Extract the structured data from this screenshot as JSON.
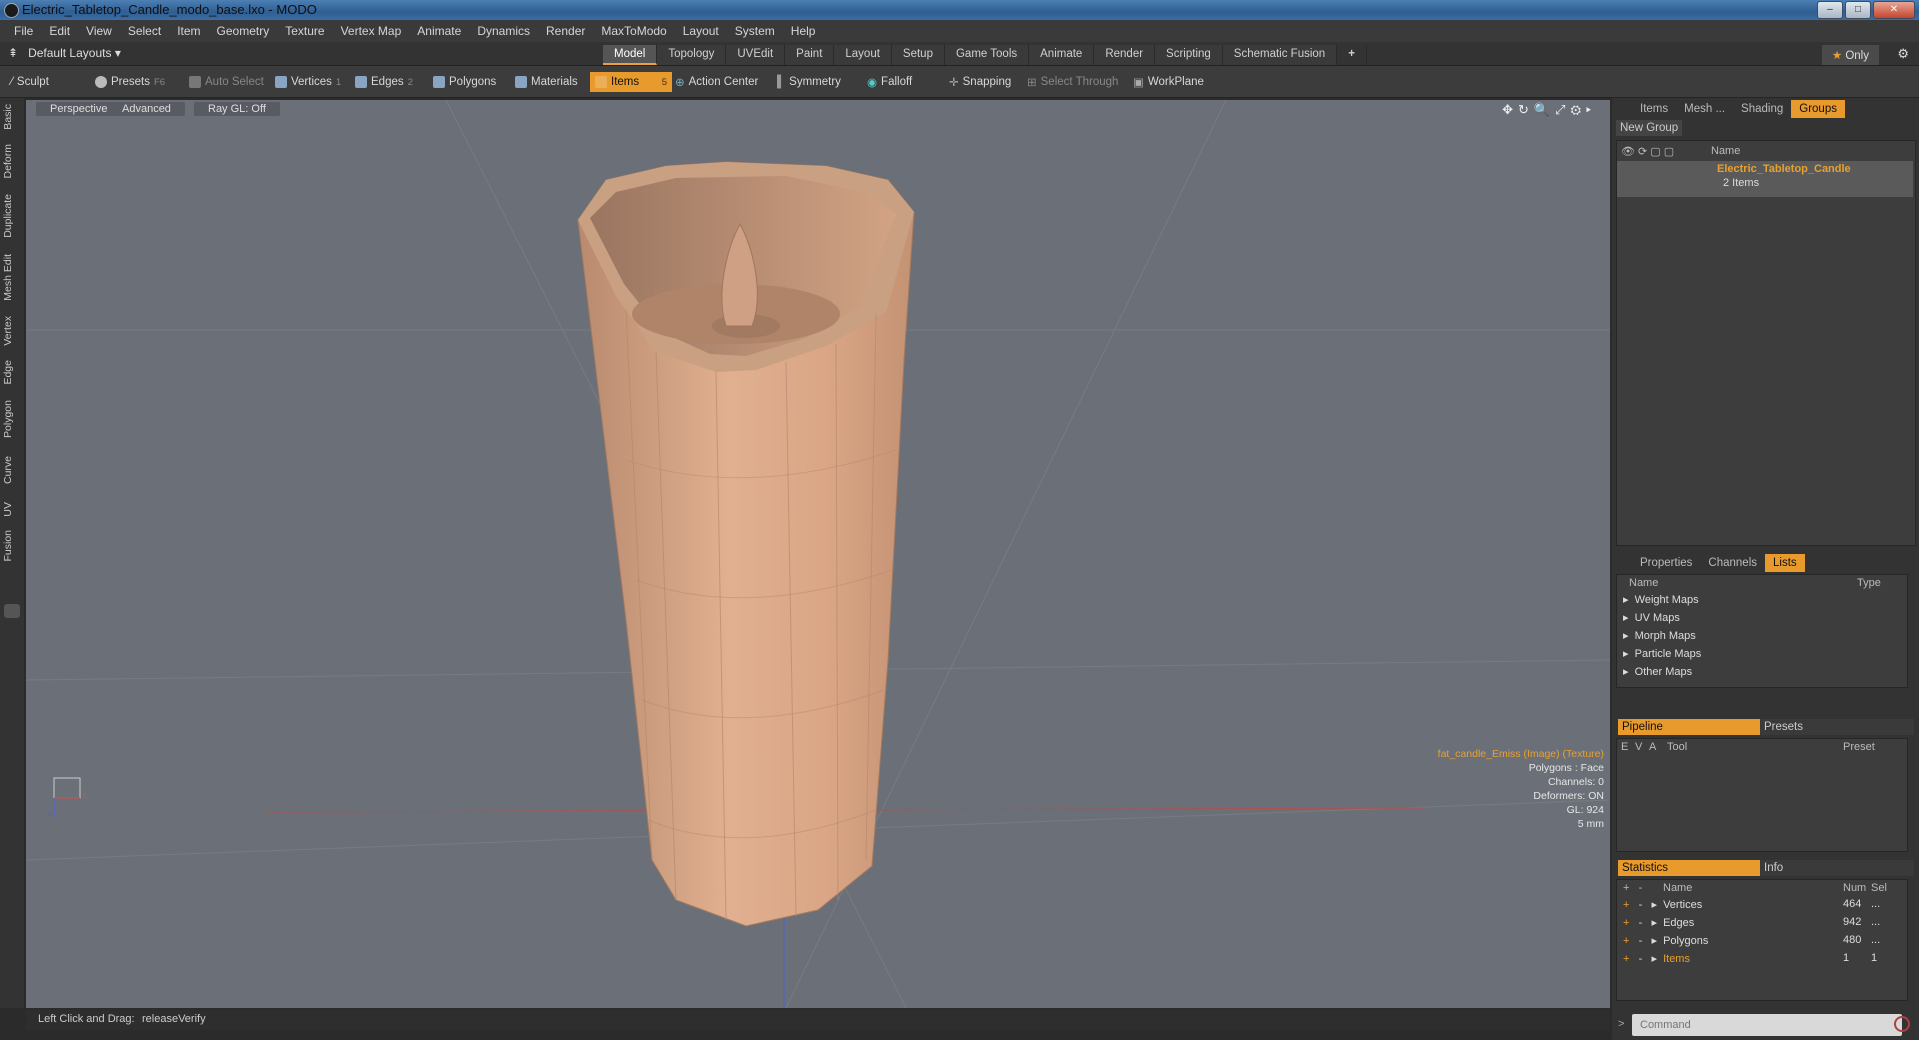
{
  "window": {
    "title": "Electric_Tabletop_Candle_modo_base.lxo - MODO"
  },
  "menu": [
    "File",
    "Edit",
    "View",
    "Select",
    "Item",
    "Geometry",
    "Texture",
    "Vertex Map",
    "Animate",
    "Dynamics",
    "Render",
    "MaxToModo",
    "Layout",
    "System",
    "Help"
  ],
  "layoutbar": {
    "layout": "Default Layouts",
    "tabs": [
      "Model",
      "Topology",
      "UVEdit",
      "Paint",
      "Layout",
      "Setup",
      "Game Tools",
      "Animate",
      "Render",
      "Scripting",
      "Schematic Fusion"
    ],
    "active_tab": "Model",
    "only_label": "Only"
  },
  "toolbar": {
    "sculpt": "Sculpt",
    "presets": "Presets",
    "presets_key": "F6",
    "auto_select": "Auto Select",
    "vertices": "Vertices",
    "vertices_num": "1",
    "edges": "Edges",
    "edges_num": "2",
    "polygons": "Polygons",
    "materials": "Materials",
    "items": "Items",
    "items_num": "5",
    "action_center": "Action Center",
    "symmetry": "Symmetry",
    "falloff": "Falloff",
    "snapping": "Snapping",
    "select_through": "Select Through",
    "workplane": "WorkPlane"
  },
  "lefttabs": [
    "Basic",
    "Deform",
    "Duplicate",
    "Mesh Edit",
    "Vertex",
    "Edge",
    "Polygon",
    "Curve",
    "UV",
    "Fusion"
  ],
  "viewport": {
    "view": "Perspective",
    "advanced": "Advanced",
    "raygl": "Ray GL: Off",
    "info": {
      "texture": "fat_candle_Emiss (Image) (Texture)",
      "polygons": "Polygons : Face",
      "channels": "Channels: 0",
      "deformers": "Deformers: ON",
      "gl": "GL: 924",
      "scale": "5 mm"
    }
  },
  "status": {
    "hint": "Left Click and Drag:",
    "action": "releaseVerify"
  },
  "groups_panel": {
    "tabs": [
      "Items",
      "Mesh ...",
      "Shading",
      "Groups"
    ],
    "active": "Groups",
    "new_group": "New Group",
    "col_name": "Name",
    "group_name": "Electric_Tabletop_Candle",
    "group_count": "2 Items"
  },
  "lists_panel": {
    "tabs": [
      "Properties",
      "Channels",
      "Lists"
    ],
    "active": "Lists",
    "col_name": "Name",
    "col_type": "Type",
    "items": [
      "Weight Maps",
      "UV Maps",
      "Morph Maps",
      "Particle Maps",
      "Other Maps"
    ]
  },
  "pipeline_panel": {
    "pipeline": "Pipeline",
    "presets": "Presets",
    "cols": [
      "E",
      "V",
      "A",
      "Tool",
      "Preset"
    ]
  },
  "stats_panel": {
    "statistics": "Statistics",
    "info": "Info",
    "col_name": "Name",
    "col_num": "Num",
    "col_sel": "Sel",
    "rows": [
      {
        "name": "Vertices",
        "num": "464",
        "sel": "..."
      },
      {
        "name": "Edges",
        "num": "942",
        "sel": "..."
      },
      {
        "name": "Polygons",
        "num": "480",
        "sel": "..."
      },
      {
        "name": "Items",
        "num": "1",
        "sel": "1"
      }
    ]
  },
  "command": {
    "placeholder": "Command"
  },
  "colors": {
    "accent": "#e89a2c",
    "viewport": "#6b7078",
    "candle": "#d9a585"
  }
}
